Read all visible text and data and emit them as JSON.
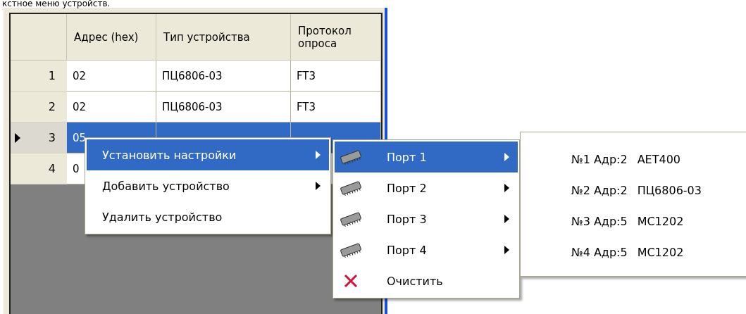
{
  "caption": "кстное меню устройств.",
  "table": {
    "columns": [
      "Адрес (hex)",
      "Тип устройства",
      "Протокол опроса"
    ],
    "rows": [
      {
        "number": "1",
        "cells": [
          "02",
          "ПЦ6806-03",
          "FT3"
        ],
        "selected": false,
        "current": false
      },
      {
        "number": "2",
        "cells": [
          "02",
          "ПЦ6806-03",
          "FT3"
        ],
        "selected": false,
        "current": false
      },
      {
        "number": "3",
        "cells": [
          "05"
        ],
        "selected": true,
        "current": true
      },
      {
        "number": "4",
        "cells": [
          "0"
        ],
        "selected": false,
        "current": false
      }
    ]
  },
  "context_menu": {
    "items": [
      {
        "label": "Установить настройки",
        "has_submenu": true,
        "selected": true
      },
      {
        "label": "Добавить устройство",
        "has_submenu": true,
        "selected": false
      },
      {
        "label": "Удалить устройство",
        "has_submenu": false,
        "selected": false
      }
    ]
  },
  "port_menu": {
    "items": [
      {
        "kind": "port",
        "label": "Порт 1",
        "has_submenu": true,
        "selected": true
      },
      {
        "kind": "port",
        "label": "Порт 2",
        "has_submenu": true,
        "selected": false
      },
      {
        "kind": "port",
        "label": "Порт 3",
        "has_submenu": true,
        "selected": false
      },
      {
        "kind": "port",
        "label": "Порт 4",
        "has_submenu": true,
        "selected": false
      },
      {
        "kind": "clear",
        "label": "Очистить",
        "has_submenu": false,
        "selected": false
      }
    ]
  },
  "device_menu": {
    "items": [
      {
        "label": "№1 Адр:2",
        "device": "AET400"
      },
      {
        "label": "№2 Адр:2",
        "device": "ПЦ6806-03"
      },
      {
        "label": "№3 Адр:5",
        "device": "MC1202"
      },
      {
        "label": "№4 Адр:5",
        "device": "MC1202"
      }
    ]
  }
}
